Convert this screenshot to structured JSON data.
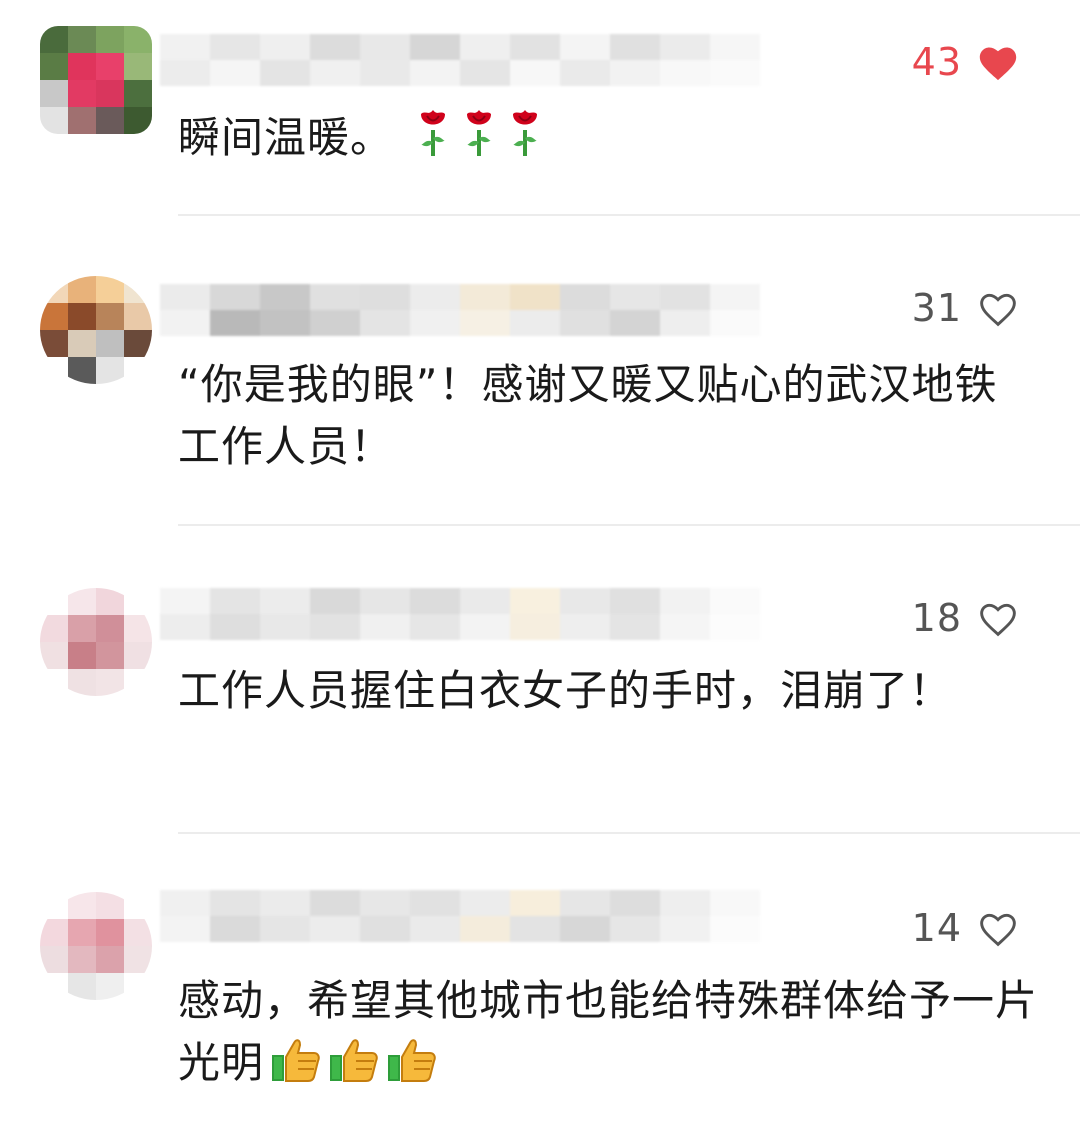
{
  "comments": [
    {
      "likes": "43",
      "liked": true,
      "text": "瞬间温暖。",
      "emoji": "rose",
      "emoji_count": 3,
      "heart_icon": "heart-filled-icon"
    },
    {
      "likes": "31",
      "liked": false,
      "text": "“你是我的眼”！感谢又暖又贴心的武汉地铁工作人员！",
      "emoji": "",
      "emoji_count": 0,
      "heart_icon": "heart-outline-icon"
    },
    {
      "likes": "18",
      "liked": false,
      "text": "工作人员握住白衣女子的手时，泪崩了！",
      "emoji": "",
      "emoji_count": 0,
      "heart_icon": "heart-outline-icon"
    },
    {
      "likes": "14",
      "liked": false,
      "text": "感动，希望其他城市也能给特殊群体给予一片光明",
      "emoji": "thumbs-up",
      "emoji_count": 3,
      "heart_icon": "heart-outline-icon"
    }
  ],
  "colors": {
    "liked": "#e8474e",
    "unliked": "#555555",
    "divider": "#ececec"
  }
}
